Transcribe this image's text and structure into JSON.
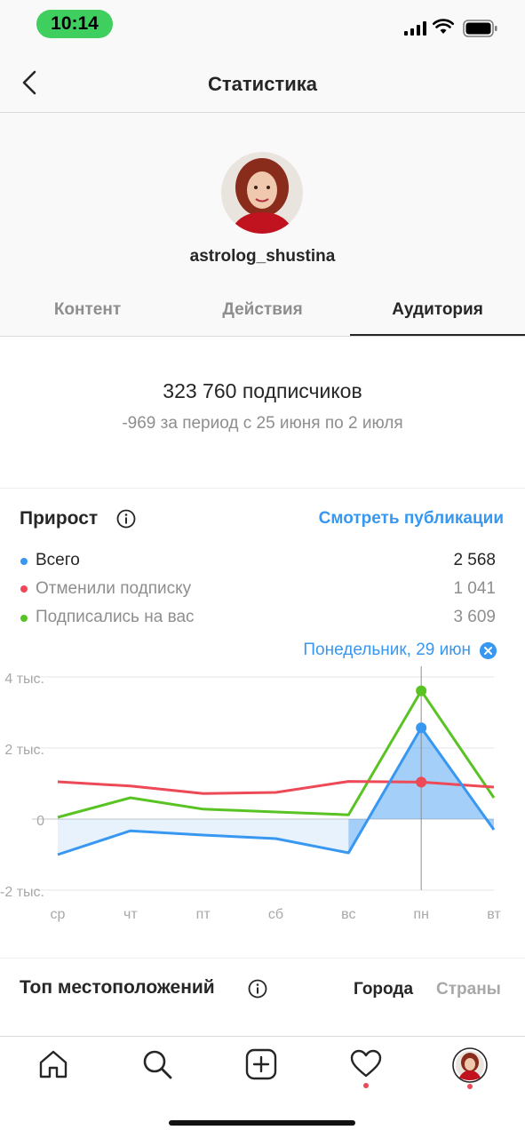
{
  "status_bar": {
    "time": "10:14"
  },
  "header": {
    "title": "Статистика"
  },
  "profile": {
    "username": "astrolog_shustina"
  },
  "tabs": [
    {
      "label": "Контент"
    },
    {
      "label": "Действия"
    },
    {
      "label": "Аудитория"
    }
  ],
  "active_tab": "Аудитория",
  "audience": {
    "followers": "323 760 подписчиков",
    "change": "-969 за период с 25 июня по 2 июля"
  },
  "growth": {
    "title": "Прирост",
    "view_posts": "Смотреть публикации",
    "legend": [
      {
        "label": "Всего",
        "value": "2 568",
        "color": "#3897f0"
      },
      {
        "label": "Отменили подписку",
        "value": "1 041",
        "color": "#ed4956"
      },
      {
        "label": "Подписались на вас",
        "value": "3 609",
        "color": "#58c322"
      }
    ],
    "selected_day": "Понедельник, 29 июн"
  },
  "chart_data": {
    "type": "line",
    "categories": [
      "ср",
      "чт",
      "пт",
      "сб",
      "вс",
      "пн",
      "вт"
    ],
    "y_ticks": [
      "4 тыс.",
      "2 тыс.",
      "0",
      "-2 тыс."
    ],
    "ylim": [
      -2000,
      4000
    ],
    "series": [
      {
        "name": "Подписались на вас",
        "color": "#58c322",
        "values": [
          50,
          600,
          280,
          200,
          120,
          3609,
          600
        ]
      },
      {
        "name": "Отменили подписку",
        "color": "#ed4956",
        "values": [
          1050,
          930,
          720,
          750,
          1060,
          1041,
          900
        ]
      },
      {
        "name": "Всего",
        "color": "#3897f0",
        "values": [
          -1000,
          -330,
          -450,
          -550,
          -950,
          2568,
          -300
        ]
      }
    ],
    "highlight_index": 5,
    "grid": true
  },
  "locations": {
    "title": "Топ местоположений",
    "tab_cities": "Города",
    "tab_countries": "Страны"
  },
  "nav": {
    "items": [
      {
        "icon": "home-icon"
      },
      {
        "icon": "search-icon"
      },
      {
        "icon": "plus-square-icon"
      },
      {
        "icon": "heart-icon"
      },
      {
        "icon": "profile-avatar-icon"
      }
    ]
  }
}
